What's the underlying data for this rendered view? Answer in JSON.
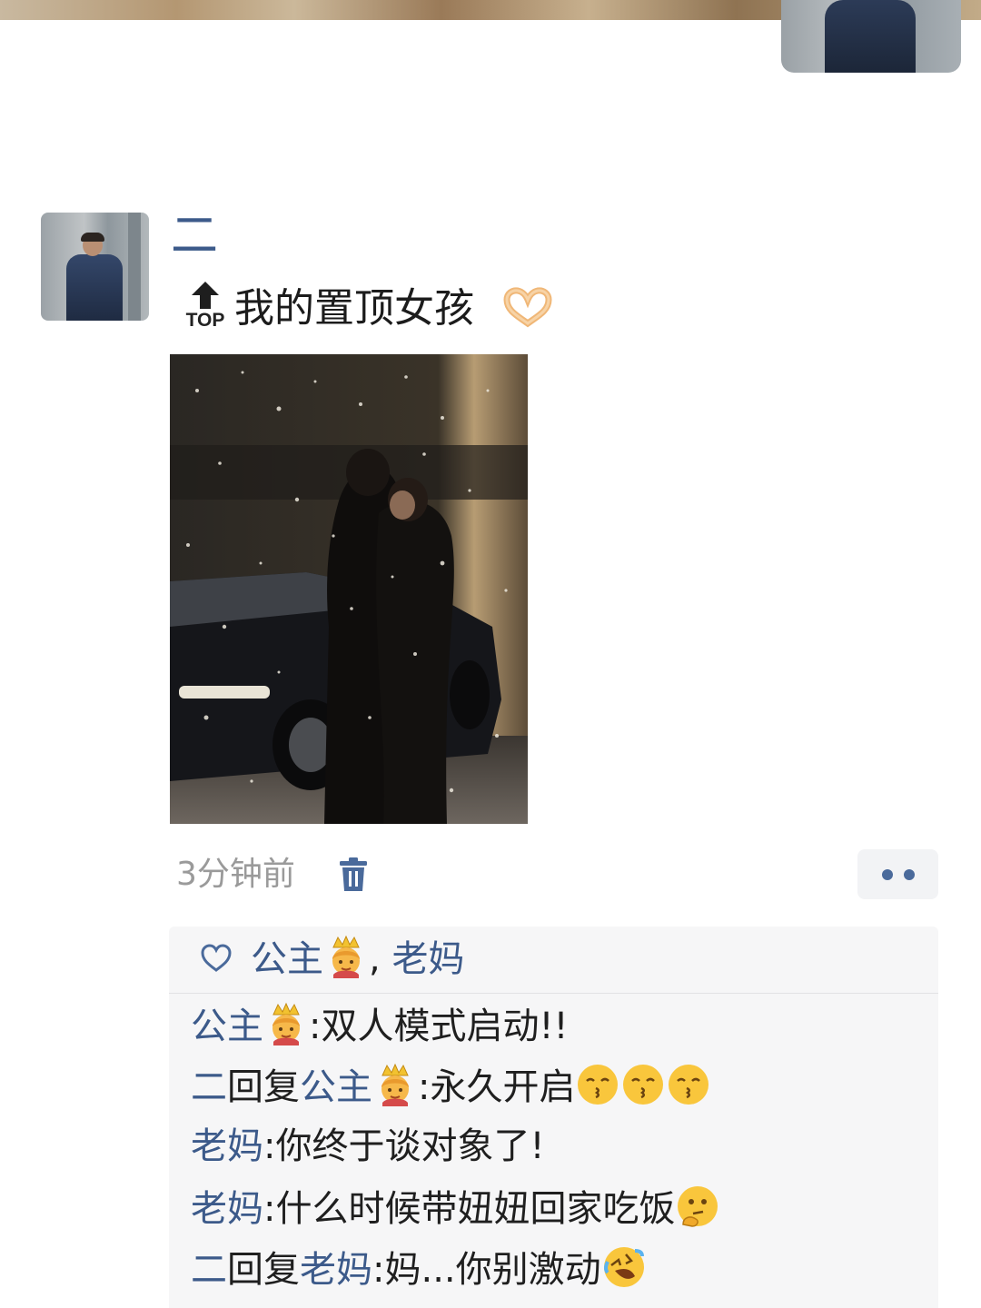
{
  "post": {
    "user_name": "二",
    "pin_badge": "TOP",
    "text": "我的置顶女孩",
    "time": "3分钟前",
    "icons": {
      "delete": "trash-icon",
      "more": "more-dots-icon",
      "like": "heart-outline-icon",
      "pinned": "pin-top-icon"
    }
  },
  "likes": {
    "names": [
      "公主",
      "老妈"
    ],
    "separator": ","
  },
  "comments": [
    {
      "author": "公主",
      "reply_to": null,
      "text": "双人模式启动!!"
    },
    {
      "author": "二",
      "reply_word": "回复",
      "reply_to": "公主",
      "text": "永久开启"
    },
    {
      "author": "老妈",
      "reply_to": null,
      "text": "你终于谈对象了!"
    },
    {
      "author": "老妈",
      "reply_to": null,
      "text": "什么时候带妞妞回家吃饭"
    },
    {
      "author": "二",
      "reply_word": "回复",
      "reply_to": "老妈",
      "text": "妈...你别激动"
    }
  ],
  "colors": {
    "link_blue": "#3c5a8a",
    "meta_gray": "#9a9a9a",
    "panel_bg": "#f6f6f7"
  },
  "colon": ":"
}
